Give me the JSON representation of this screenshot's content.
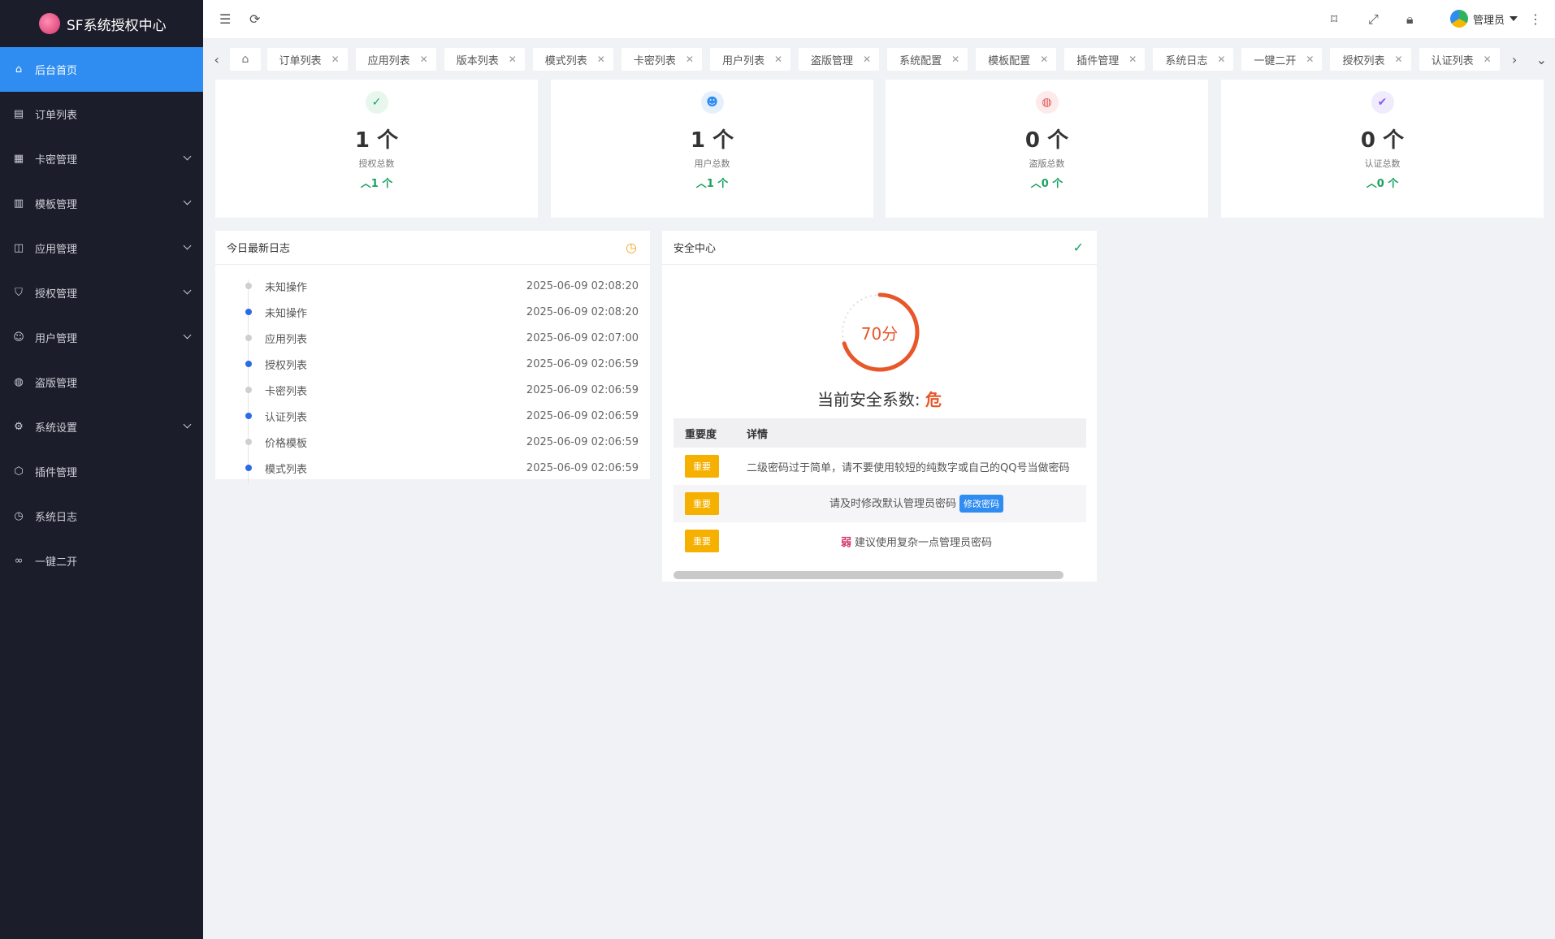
{
  "app": {
    "title": "SF系统授权中心"
  },
  "sidebar": {
    "items": [
      {
        "label": "后台首页",
        "icon": "home-icon",
        "active": true,
        "expandable": false
      },
      {
        "label": "订单列表",
        "icon": "doc-icon",
        "expandable": false
      },
      {
        "label": "卡密管理",
        "icon": "grid-icon",
        "expandable": true
      },
      {
        "label": "模板管理",
        "icon": "template-icon",
        "expandable": true
      },
      {
        "label": "应用管理",
        "icon": "apps-icon",
        "expandable": true
      },
      {
        "label": "授权管理",
        "icon": "shield-icon",
        "expandable": true
      },
      {
        "label": "用户管理",
        "icon": "user-icon",
        "expandable": true
      },
      {
        "label": "盗版管理",
        "icon": "globe-icon",
        "expandable": false
      },
      {
        "label": "系统设置",
        "icon": "gear-icon",
        "expandable": true
      },
      {
        "label": "插件管理",
        "icon": "box-icon",
        "expandable": false
      },
      {
        "label": "系统日志",
        "icon": "clock-icon",
        "expandable": false
      },
      {
        "label": "一键二开",
        "icon": "infinity-icon",
        "expandable": false
      }
    ]
  },
  "topbar": {
    "admin_label": "管理员"
  },
  "tabs": [
    {
      "label": "订单列表"
    },
    {
      "label": "应用列表"
    },
    {
      "label": "版本列表"
    },
    {
      "label": "模式列表"
    },
    {
      "label": "卡密列表"
    },
    {
      "label": "用户列表"
    },
    {
      "label": "盗版管理"
    },
    {
      "label": "系统配置"
    },
    {
      "label": "模板配置"
    },
    {
      "label": "插件管理"
    },
    {
      "label": "系统日志"
    },
    {
      "label": "一键二开"
    },
    {
      "label": "授权列表"
    },
    {
      "label": "认证列表"
    }
  ],
  "stats": [
    {
      "value": "1 个",
      "label": "授权总数",
      "trend": "1 个",
      "color": "#19a15f",
      "bg": "#e8f7ee",
      "icon": "shield-check-icon"
    },
    {
      "value": "1 个",
      "label": "用户总数",
      "trend": "1 个",
      "color": "#2f8cf0",
      "bg": "#e6f0fd",
      "icon": "users-icon"
    },
    {
      "value": "0 个",
      "label": "盗版总数",
      "trend": "0 个",
      "color": "#e04f4f",
      "bg": "#fdeaea",
      "icon": "globe-icon"
    },
    {
      "value": "0 个",
      "label": "认证总数",
      "trend": "0 个",
      "color": "#8b5cf6",
      "bg": "#f1ebfe",
      "icon": "check-circle-icon"
    }
  ],
  "logs": {
    "title": "今日最新日志",
    "rows": [
      {
        "name": "未知操作",
        "time": "2025-06-09 02:08:20",
        "highlight": false
      },
      {
        "name": "未知操作",
        "time": "2025-06-09 02:08:20",
        "highlight": true
      },
      {
        "name": "应用列表",
        "time": "2025-06-09 02:07:00",
        "highlight": false
      },
      {
        "name": "授权列表",
        "time": "2025-06-09 02:06:59",
        "highlight": true
      },
      {
        "name": "卡密列表",
        "time": "2025-06-09 02:06:59",
        "highlight": false
      },
      {
        "name": "认证列表",
        "time": "2025-06-09 02:06:59",
        "highlight": true
      },
      {
        "name": "价格模板",
        "time": "2025-06-09 02:06:59",
        "highlight": false
      },
      {
        "name": "模式列表",
        "time": "2025-06-09 02:06:59",
        "highlight": true
      }
    ]
  },
  "security": {
    "title": "安全中心",
    "score": 70,
    "score_label": "70分",
    "status_prefix": "当前安全系数:",
    "status_level": "危",
    "col_importance": "重要度",
    "col_detail": "详情",
    "rows": [
      {
        "badge": "重要",
        "detail": "二级密码过于简单，请不要使用较短的纯数字或自己的QQ号当做密码"
      },
      {
        "badge": "重要",
        "detail": "请及时修改默认管理员密码",
        "action": "修改密码"
      },
      {
        "badge": "重要",
        "weak": "弱",
        "detail": "建议使用复杂一点管理员密码"
      }
    ]
  }
}
